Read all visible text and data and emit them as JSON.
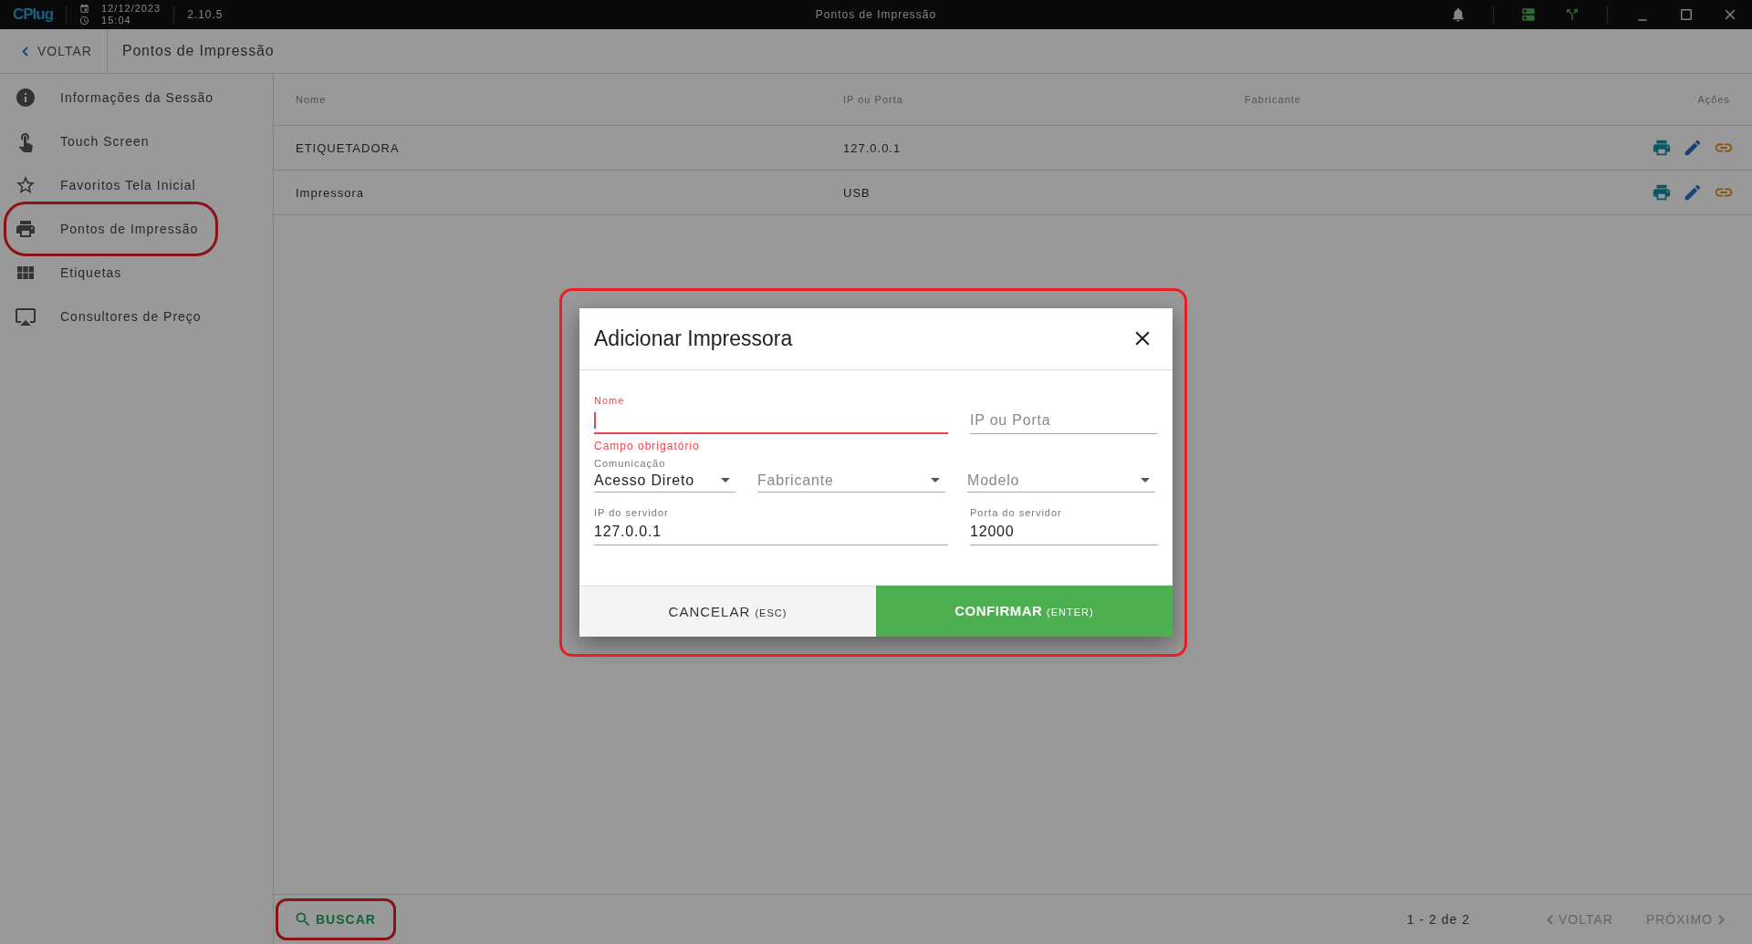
{
  "title_bar": {
    "logo": "CPlug",
    "date": "12/12/2023",
    "time": "15:04",
    "version": "2.10.5",
    "title": "Pontos de Impressão"
  },
  "header": {
    "back": "VOLTAR",
    "title": "Pontos de Impressão"
  },
  "sidebar": {
    "items": [
      {
        "label": "Informações da Sessão",
        "highlighted": false
      },
      {
        "label": "Touch Screen",
        "highlighted": false
      },
      {
        "label": "Favoritos Tela Inicial",
        "highlighted": false
      },
      {
        "label": "Pontos de Impressão",
        "highlighted": true
      },
      {
        "label": "Etiquetas",
        "highlighted": false
      },
      {
        "label": "Consultores de Preço",
        "highlighted": false
      }
    ]
  },
  "table": {
    "columns": [
      "Nome",
      "IP ou Porta",
      "Fabricante",
      "Ações"
    ],
    "rows": [
      {
        "cells": [
          "ETIQUETADORA",
          "127.0.0.1"
        ]
      },
      {
        "cells": [
          "Impressora",
          "USB"
        ]
      }
    ]
  },
  "footer": {
    "search": {
      "label": "BUSCAR",
      "highlighted": true
    },
    "range": "1 - 2 de 2",
    "prev": {
      "label": "VOLTAR",
      "disabled": true
    },
    "next": {
      "label": "PRÓXIMO",
      "disabled": true
    }
  },
  "dialog": {
    "title": "Adicionar Impressora",
    "highlighted": true,
    "name_field": {
      "label": "Nome",
      "error": "Campo obrigatório",
      "invalid": true
    },
    "ip_field": {
      "placeholder": "IP ou Porta"
    },
    "selects": [
      {
        "label": "Comunicação",
        "value": "Acesso Direto"
      },
      {
        "placeholder": "Fabricante"
      },
      {
        "placeholder": "Modelo"
      }
    ],
    "server_ip": {
      "label": "IP do servidor",
      "value": "127.0.0.1"
    },
    "server_port": {
      "label": "Porta do servidor",
      "value": "12000"
    },
    "cancel": {
      "label": "CANCELAR",
      "hint": "(ESC)"
    },
    "confirm": {
      "label": "CONFIRMAR",
      "hint": "(ENTER)"
    }
  }
}
